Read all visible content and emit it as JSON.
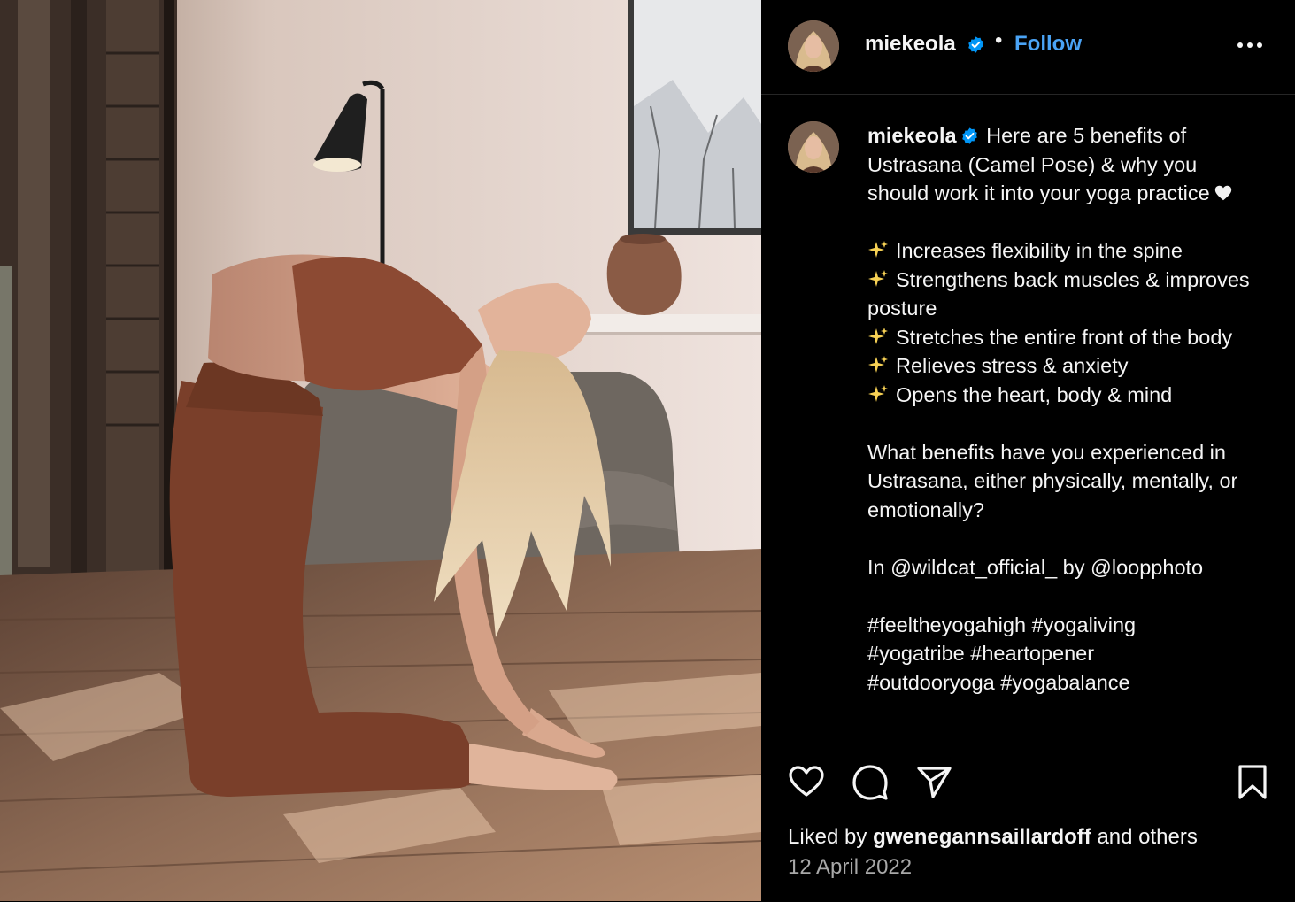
{
  "post": {
    "username": "miekeola",
    "follow_label": "Follow",
    "dot": "•"
  },
  "caption": {
    "username": "miekeola",
    "intro": "Here are 5 benefits of Ustrasana (Camel Pose) & why you should work it into your yoga practice",
    "benefits": [
      "Increases flexibility in the spine",
      "Strengthens back muscles & improves posture",
      "Stretches the entire front of the body",
      "Relieves stress & anxiety",
      "Opens the heart, body & mind"
    ],
    "question": "What benefits have you experienced in Ustrasana, either physically, mentally, or emotionally?",
    "credit": "In @wildcat_official_ by @loopphoto",
    "hashtags_line1": "#feeltheyogahigh #yogaliving",
    "hashtags_line2": "#yogatribe #heartopener",
    "hashtags_line3": "#outdooryoga #yogabalance"
  },
  "likes": {
    "prefix": "Liked by",
    "user": "gwenegannsaillardoff",
    "suffix": "and others"
  },
  "date": "12 April 2022",
  "icons": {
    "verified": "verified-badge-icon",
    "more": "more-options-icon",
    "like": "heart-outline-icon",
    "comment": "comment-bubble-icon",
    "share": "paper-plane-icon",
    "save": "bookmark-icon",
    "emoji_heart": "white-heart-emoji-icon",
    "emoji_sparkles": "sparkles-emoji-icon"
  },
  "colors": {
    "background": "#000000",
    "text": "#f5f5f5",
    "accent": "#4aa3f5",
    "muted": "#a8a8a8",
    "divider": "#262626"
  }
}
